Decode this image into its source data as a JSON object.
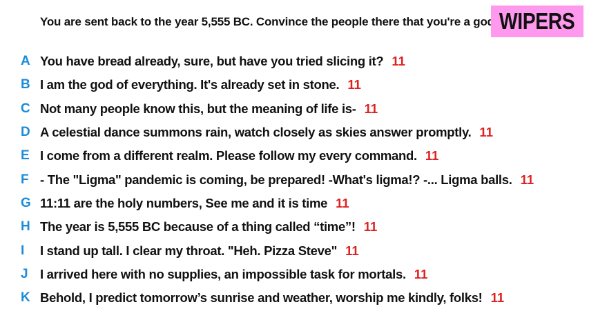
{
  "prompt": "You are sent back to the year 5,555 BC. Convince the people there that you're a god.",
  "badge": {
    "label": "WIPERS",
    "color": "#ff99ee"
  },
  "colors": {
    "letter": "#1a8cd8",
    "score": "#e02020",
    "text": "#111111"
  },
  "answers": [
    {
      "letter": "A",
      "text": "You have bread already, sure, but have you tried slicing it?",
      "score": "11"
    },
    {
      "letter": "B",
      "text": "I am the god of everything. It's already set in stone.",
      "score": "11"
    },
    {
      "letter": "C",
      "text": "Not many people know this, but the meaning of life is-",
      "score": "11"
    },
    {
      "letter": "D",
      "text": "A celestial dance summons rain, watch closely as skies answer promptly.",
      "score": "11"
    },
    {
      "letter": "E",
      "text": "I come from a different realm. Please follow my every command.",
      "score": "11"
    },
    {
      "letter": "F",
      "text": "- The \"Ligma\" pandemic is coming, be prepared! -What's ligma!?  -... Ligma balls.",
      "score": "11"
    },
    {
      "letter": "G",
      "text": "11:11 are the holy numbers, See me and it is time",
      "score": "11"
    },
    {
      "letter": "H",
      "text": "The year is 5,555 BC because of a thing called “time”!",
      "score": "11"
    },
    {
      "letter": "I",
      "text": "I stand up tall. I clear my throat. \"Heh. Pizza Steve\"",
      "score": "11"
    },
    {
      "letter": "J",
      "text": "I arrived here with no supplies, an impossible task for mortals.",
      "score": "11"
    },
    {
      "letter": "K",
      "text": "Behold, I predict tomorrow’s sunrise and weather, worship me kindly, folks!",
      "score": "11"
    }
  ]
}
